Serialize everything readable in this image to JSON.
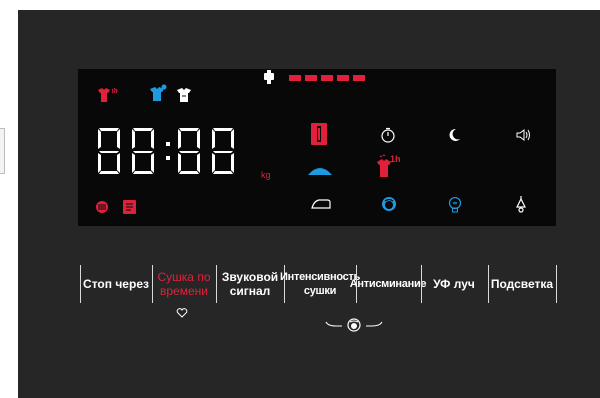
{
  "display": {
    "time_digits": "88:88",
    "unit_label": "kg",
    "progress_segments": 5,
    "colors": {
      "red": "#e0213b",
      "blue": "#1e9be0",
      "white": "#ffffff",
      "panel": "#262626",
      "screen": "#080808"
    },
    "icons": [
      "shirt-steam-icon",
      "shirt-blue-icon",
      "shirt-white-icon",
      "water-tap-icon",
      "dial-icon",
      "timer-icon",
      "night-mode-icon",
      "sound-icon",
      "drying-arc-icon",
      "shirt-1h-icon",
      "sunshade-icon",
      "iron-icon",
      "face-icon",
      "bulb-icon",
      "lamp-icon",
      "filter-icon",
      "book-icon"
    ],
    "shirt_1h_label": "1h"
  },
  "buttons": [
    {
      "label": "Стоп через",
      "active": false
    },
    {
      "label": "Сушка по\nвремени",
      "active": true
    },
    {
      "label": "Звуковой\nсигнал",
      "active": false
    },
    {
      "label": "Интенсивность\nсушки",
      "active": false
    },
    {
      "label": "Антисминание",
      "active": false
    },
    {
      "label": "УФ луч",
      "active": false
    },
    {
      "label": "Подсветка",
      "active": false
    }
  ]
}
